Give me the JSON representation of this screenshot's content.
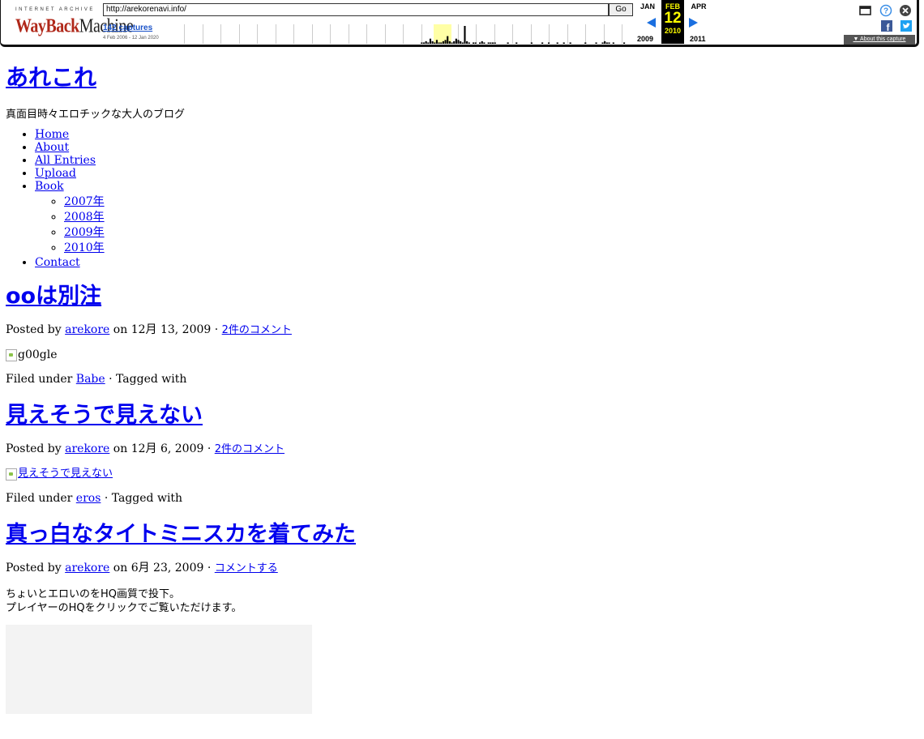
{
  "wayback": {
    "ia_label": "INTERNET ARCHIVE",
    "logo_part1": "WayBack",
    "logo_part2": "Machine",
    "url": "http://arekorenavi.info/",
    "go_label": "Go",
    "captures_label": "142 captures",
    "date_range": "4 Feb 2006 - 12 Jan 2020",
    "prev_month": "JAN",
    "current_month": "FEB",
    "next_month": "APR",
    "current_day": "12",
    "prev_year": "2009",
    "current_year": "2010",
    "next_year": "2011",
    "about_label": "About this capture",
    "capture_histogram": [
      0,
      0,
      0,
      0,
      0,
      0,
      0,
      0,
      0,
      0,
      0,
      0,
      0,
      0,
      0,
      0,
      0,
      0,
      0,
      0,
      0,
      0,
      0,
      0,
      0,
      0,
      0,
      0,
      0,
      0,
      0,
      0,
      0,
      0,
      0,
      0,
      0,
      0,
      0,
      0,
      0,
      0,
      0,
      0,
      0,
      0,
      0,
      0,
      0,
      0,
      0,
      0,
      0,
      0,
      0,
      0,
      0,
      0,
      0,
      0,
      0,
      0,
      0,
      0,
      0,
      0,
      0,
      0,
      0,
      0,
      0,
      0,
      0,
      0,
      0,
      0,
      0,
      0,
      0,
      0,
      0,
      0,
      0,
      0,
      0,
      0,
      0,
      0,
      0,
      0,
      0,
      0,
      0,
      0,
      0,
      0,
      0,
      0,
      0,
      0,
      0,
      0,
      0,
      0,
      0,
      0,
      0,
      0,
      0,
      0,
      1,
      1,
      2,
      1,
      4,
      2,
      1,
      3,
      1,
      1,
      2,
      3,
      6,
      2,
      1,
      2,
      4,
      3,
      2,
      1,
      14,
      2,
      1,
      0,
      1,
      1,
      0,
      1,
      2,
      1,
      0,
      1,
      1,
      1,
      1,
      0,
      0,
      0,
      0,
      0,
      1,
      0,
      0,
      0,
      1,
      0,
      0,
      0,
      0,
      0,
      0,
      1,
      0,
      0,
      0,
      0,
      1,
      0,
      0,
      1,
      0,
      0,
      0,
      1,
      0,
      0,
      1,
      0,
      0,
      1,
      0,
      0,
      0,
      0,
      0,
      0,
      1,
      0,
      0,
      0,
      0,
      1,
      0,
      0,
      1,
      2,
      1,
      1,
      0,
      1,
      0,
      0,
      0,
      0,
      1,
      0,
      0
    ]
  },
  "site": {
    "title": "あれこれ",
    "description": "真面目時々エロチックな大人のブログ"
  },
  "nav": {
    "items": [
      "Home",
      "About",
      "All Entries",
      "Upload",
      "Book"
    ],
    "book_years": [
      "2007年",
      "2008年",
      "2009年",
      "2010年"
    ],
    "contact": "Contact"
  },
  "posts": [
    {
      "title": "ooは別注",
      "posted_by": "Posted by",
      "author": "arekore",
      "on_date": "on 12月 13, 2009 ·",
      "comments": "2件のコメント",
      "image_alt": "g00gle",
      "filed_under": "Filed under",
      "category": "Babe",
      "tagged": "· Tagged with"
    },
    {
      "title": "見えそうで見えない",
      "posted_by": "Posted by",
      "author": "arekore",
      "on_date": "on 12月 6, 2009 ·",
      "comments": "2件のコメント",
      "image_alt": "見えそうで見えない",
      "filed_under": "Filed under",
      "category": "eros",
      "tagged": "· Tagged with"
    },
    {
      "title": "真っ白なタイトミニスカを着てみた",
      "posted_by": "Posted by",
      "author": "arekore",
      "on_date": "on 6月 23, 2009 ·",
      "comments": "コメントする",
      "body_line1": "ちょいとエロいのをHQ画質で投下。",
      "body_line2": "プレイヤーのHQをクリックでご覧いただけます。"
    }
  ]
}
